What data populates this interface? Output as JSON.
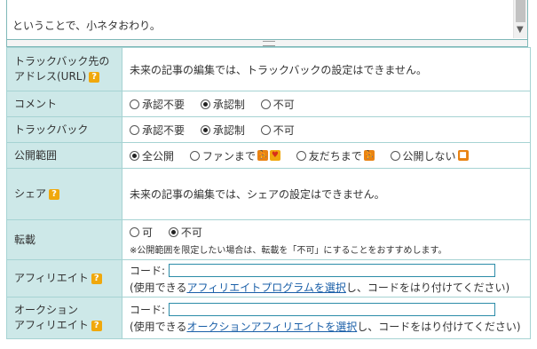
{
  "textarea": {
    "text": "ということで、小ネタおわり。"
  },
  "rows": {
    "trackback_url": {
      "label": "トラックバック先のアドレス(URL)",
      "value": "未来の記事の編集では、トラックバックの設定はできません。"
    },
    "comment": {
      "label": "コメント",
      "options": [
        "承認不要",
        "承認制",
        "不可"
      ],
      "selected": 1
    },
    "trackback": {
      "label": "トラックバック",
      "options": [
        "承認不要",
        "承認制",
        "不可"
      ],
      "selected": 1
    },
    "visibility": {
      "label": "公開範囲",
      "options": [
        "全公開",
        "ファンまで",
        "友だちまで",
        "公開しない"
      ],
      "selected": 0
    },
    "share": {
      "label": "シェア",
      "value": "未来の記事の編集では、シェアの設定はできません。"
    },
    "repost": {
      "label": "転載",
      "options": [
        "可",
        "不可"
      ],
      "selected": 1,
      "note": "※公開範囲を限定したい場合は、転載を「不可」にすることをおすすめします。"
    },
    "affiliate": {
      "label": "アフィリエイト",
      "code_label": "コード:",
      "code_value": "",
      "help_prefix": "(使用できる",
      "help_link": "アフィリエイトプログラムを選択",
      "help_suffix": "し、コードをはり付けてください)"
    },
    "auction_affiliate": {
      "label_line1": "オークション",
      "label_line2": "アフィリエイト",
      "code_label": "コード:",
      "code_value": "",
      "help_prefix": "(使用できる",
      "help_link": "オークションアフィリエイトを選択",
      "help_suffix": "し、コードをはり付けてください)"
    }
  },
  "colors": {
    "label_bg": "#cde8e8",
    "border": "#a6d3d3",
    "help_icon": "#f0a80c",
    "link": "#1a5fa8"
  },
  "icons": {
    "help": "?",
    "friends": "friends-icon",
    "heart": "heart-icon",
    "lock": "lock-icon"
  }
}
